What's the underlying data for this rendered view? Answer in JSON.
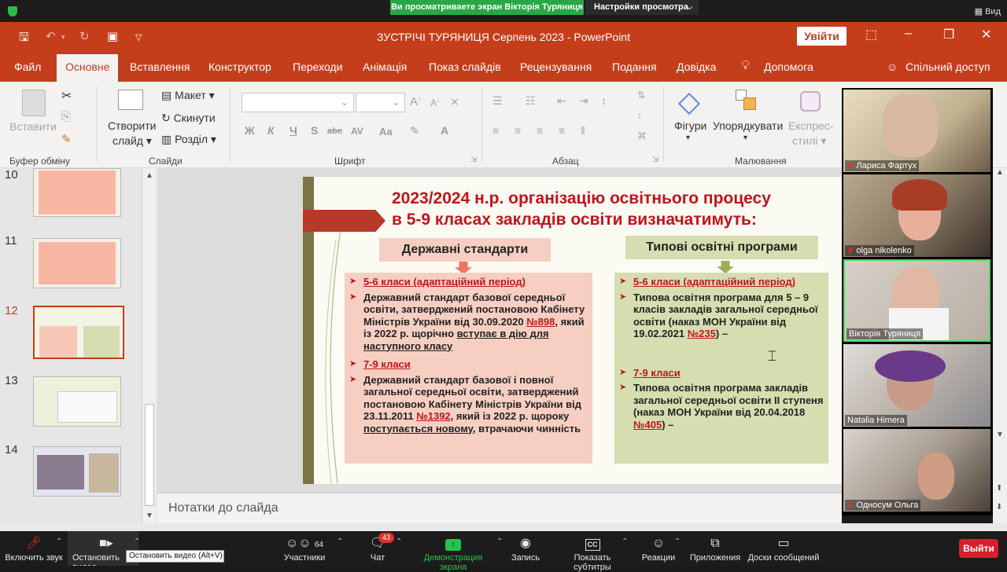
{
  "zoom_top": {
    "share_banner": "Ви просматриваете экран Вікторія Туряниця",
    "view_settings": "Настройки просмотра",
    "view_label": "Вид"
  },
  "titlebar": {
    "title": "ЗУСТРІЧІ ТУРЯНИЦЯ Серпень 2023  -  PowerPoint",
    "sign_in": "Увійти"
  },
  "tabs": [
    "Файл",
    "Основне",
    "Вставлення",
    "Конструктор",
    "Переходи",
    "Анімація",
    "Показ слайдів",
    "Рецензування",
    "Подання",
    "Довідка",
    "Допомога",
    "Спільний доступ"
  ],
  "ribbon": {
    "paste": "Вставити",
    "clipboard_group": "Буфер обміну",
    "new_slide_line1": "Створити",
    "new_slide_line2": "слайд",
    "layout": "Макет",
    "reset": "Скинути",
    "section": "Розділ",
    "slides_group": "Слайди",
    "font_group": "Шрифт",
    "paragraph_group": "Абзац",
    "shapes": "Фігури",
    "arrange": "Упорядкувати",
    "quick_styles_line1": "Експрес-",
    "quick_styles_line2": "стилі",
    "drawing_group": "Малювання",
    "fmt_bold": "Ж",
    "fmt_italic": "К",
    "fmt_underline": "Ч",
    "fmt_strike": "S",
    "fmt_abc": "abc",
    "fmt_spacing": "AV",
    "fmt_case": "Aa",
    "font_grow": "A",
    "font_shrink": "A"
  },
  "thumbnails": [
    {
      "num": "10"
    },
    {
      "num": "11"
    },
    {
      "num": "12"
    },
    {
      "num": "13"
    },
    {
      "num": "14"
    }
  ],
  "slide": {
    "title_line1": "2023/2024 н.р. організацію освітнього процесу",
    "title_line2": "в 5-9 класах закладів освіти визначатимуть:",
    "left_header": "Державні стандарти",
    "right_header": "Типові освітні програми",
    "left": {
      "sub1": "5-6 класи (адаптаційний період)",
      "p1_a": "Державний стандарт базової середньої освіти, затверджений постановою Кабінету Міністрів України від 30.09.2020 ",
      "p1_num": "№898",
      "p1_b": ", який із 2022 р. щорічно ",
      "p1_c": "вступає в дію для наступного класу",
      "sub2": "7-9 класи",
      "p2_a": "Державний стандарт базової  і повної загальної середньої освіти, затверджений постановою Кабінету Міністрів України від 23.11.2011 ",
      "p2_num": "№1392",
      "p2_b": ", який із 2022 р. щороку ",
      "p2_c": "поступається новому,",
      "p2_d": " втрачаючи чинність"
    },
    "right": {
      "sub1": "5-6 класи (адаптаційний період)",
      "p1_a": "Типова освітня програма для 5 – 9 класів закладів загальної середньої освіти (наказ МОН України від 19.02.2021 ",
      "p1_num": "№235",
      "p1_b": ") –",
      "sub2": "7-9 класи",
      "p2_a": "Типова освітня програма закладів загальної середньої освіти ІІ ступеня (наказ МОН України від 20.04.2018 ",
      "p2_num": "№405",
      "p2_b": ") –"
    }
  },
  "notes_placeholder": "Нотатки до слайда",
  "participants_video": [
    {
      "name": "Лариса Фартух",
      "muted": true
    },
    {
      "name": "olga nikolenko",
      "muted": true
    },
    {
      "name": "Вікторія Туряниця",
      "muted": false
    },
    {
      "name": "Natalia Himera",
      "muted": false
    },
    {
      "name": "Односум Ольга",
      "muted": true
    }
  ],
  "zoom_bar": {
    "mute": "Включить звук",
    "stop_video": "Остановить видео",
    "participants": "Участники",
    "participants_count": "64",
    "chat": "Чат",
    "chat_badge": "43",
    "share": "Демонстрация экрана",
    "record": "Запись",
    "captions": "Показать субтитры",
    "reactions": "Реакции",
    "apps": "Приложения",
    "whiteboards": "Доски сообщений",
    "leave": "Выйти",
    "tooltip": "Остановить видео (Alt+V)"
  },
  "colors": {
    "ppt_accent": "#c43e1c",
    "slide_red": "#c0141b",
    "left_box": "#f7cfc2",
    "right_box": "#d6ddb0",
    "zoom_green": "#27a844",
    "zoom_red": "#d8202a"
  }
}
